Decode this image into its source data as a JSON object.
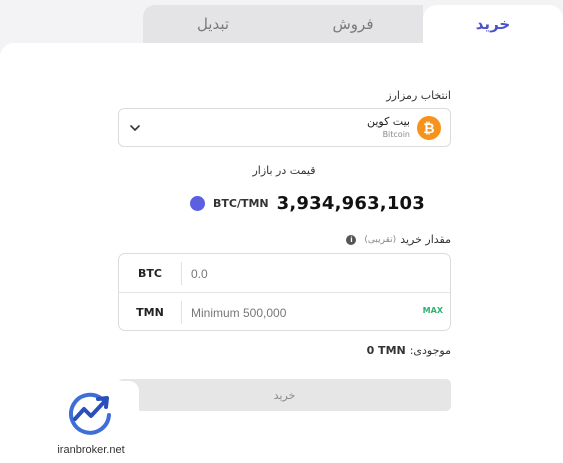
{
  "tabs": [
    {
      "label": "تبدیل"
    },
    {
      "label": "فروش"
    },
    {
      "label": "خرید",
      "active": true
    }
  ],
  "crypto_select": {
    "label": "انتخاب رمزارز",
    "coin_name": "بیت کوین",
    "coin_sub": "Bitcoin",
    "coin_symbol": "₿"
  },
  "market": {
    "label": "قیمت در بازار",
    "pair": "BTC/TMN",
    "price": "3,934,963,103"
  },
  "amount": {
    "label": "مقدار خرید",
    "hint": "(تقریبی)",
    "info_glyph": "i",
    "rows": [
      {
        "unit": "BTC",
        "placeholder": "0.0"
      },
      {
        "unit": "TMN",
        "placeholder": "Minimum 500,000",
        "max_label": "MAX"
      }
    ]
  },
  "balance": {
    "label": "موجودی:",
    "value": "0 TMN"
  },
  "buy_button": {
    "label": "خرید"
  },
  "watermark": {
    "text": "iranbroker.net"
  },
  "colors": {
    "accent": "#4c52c9",
    "bitcoin": "#f7931a",
    "dot": "#5b5fe0",
    "max": "#2db36b"
  }
}
